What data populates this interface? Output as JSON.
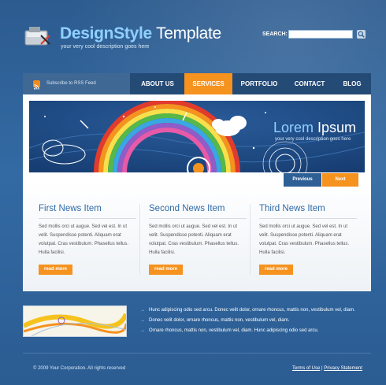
{
  "header": {
    "logo_title_main": "DesignStyle",
    "logo_title_rest": " Template",
    "logo_subtitle": "your very cool description goes here",
    "search_label": "SEARCH:",
    "search_value": ""
  },
  "nav": {
    "rss_label": "Subscribe to RSS Feed",
    "items": [
      {
        "label": "ABOUT US"
      },
      {
        "label": "SERVICES",
        "active": true
      },
      {
        "label": "PORTFOLIO"
      },
      {
        "label": "CONTACT"
      },
      {
        "label": "BLOG"
      }
    ]
  },
  "banner": {
    "title_main": "Lorem",
    "title_rest": " Ipsum",
    "subtitle": "your very cool description goes here",
    "prev_label": "Previous",
    "next_label": "Next"
  },
  "news": [
    {
      "title": "First News Item",
      "body": "Sed mollis orci ut augue. Sed vel est. In ut velit. Suspendisse potenti. Aliquam erat volutpat. Cras vestibulum. Phasellus tellus. Hulla facilisi.",
      "button": "read more"
    },
    {
      "title": "Second News Item",
      "body": "Sed mollis orci ut augue. Sed vel est. In ut velit. Suspendisse potenti. Aliquam erat volutpat. Cras vestibulum. Phasellus tellus. Hulla facilisi.",
      "button": "read more"
    },
    {
      "title": "Third News Item",
      "body": "Sed mollis orci ut augue. Sed vel est. In ut velit. Suspendisse potenti. Aliquam erat volutpat. Cras vestibulum. Phasellus tellus. Hulla facilisi.",
      "button": "read more"
    }
  ],
  "bottom": {
    "bullets": [
      "Hunc adipiscing odio sed arcu. Donec velit dolor, ornare rhoncus, mattis non, vestibulum vel, diam.",
      "Donec velit dolor, ornare rhoncus, mattis non, vestibulum vel, diam.",
      "Ornare rhoncus, mattis non, vestibulum vel, diam. Hunc adipiscing odio sed arcu."
    ]
  },
  "footer": {
    "copyright": "© 2009 Your Corporation. All rights reserved",
    "terms_label": "Terms of Use",
    "separator": " | ",
    "privacy_label": "Privacy Statement"
  },
  "colors": {
    "accent_orange": "#f6921e",
    "brand_blue": "#2e5f95",
    "title_blue": "#2f6aa6"
  }
}
